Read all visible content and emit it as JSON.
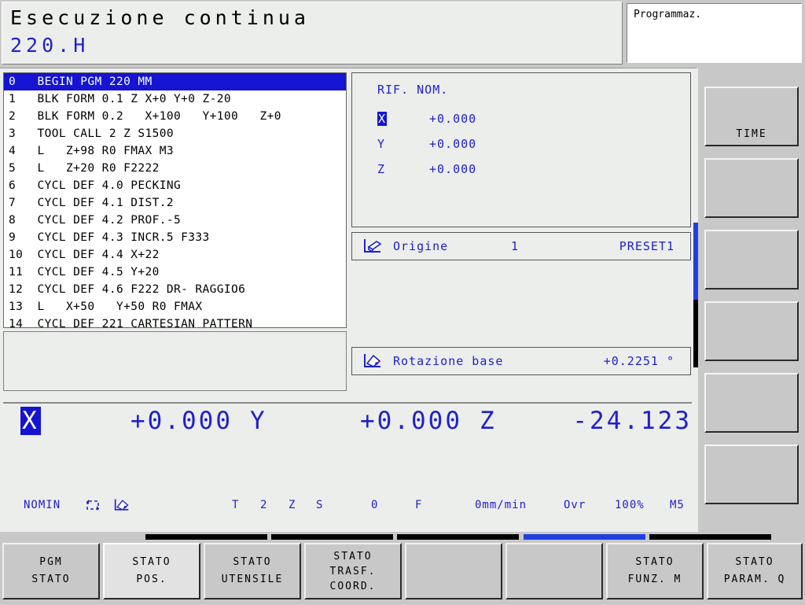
{
  "header": {
    "mode_title": "Esecuzione continua",
    "program_name": "220.H",
    "right_box_label": "Programmaz."
  },
  "program_list": {
    "lines": [
      {
        "text": "0   BEGIN PGM 220 MM",
        "selected": true
      },
      {
        "text": "1   BLK FORM 0.1 Z X+0 Y+0 Z-20",
        "selected": false
      },
      {
        "text": "2   BLK FORM 0.2   X+100   Y+100   Z+0",
        "selected": false
      },
      {
        "text": "3   TOOL CALL 2 Z S1500",
        "selected": false
      },
      {
        "text": "4   L   Z+98 R0 FMAX M3",
        "selected": false
      },
      {
        "text": "5   L   Z+20 R0 F2222",
        "selected": false
      },
      {
        "text": "6   CYCL DEF 4.0 PECKING",
        "selected": false
      },
      {
        "text": "7   CYCL DEF 4.1 DIST.2",
        "selected": false
      },
      {
        "text": "8   CYCL DEF 4.2 PROF.-5",
        "selected": false
      },
      {
        "text": "9   CYCL DEF 4.3 INCR.5 F333",
        "selected": false
      },
      {
        "text": "10  CYCL DEF 4.4 X+22",
        "selected": false
      },
      {
        "text": "11  CYCL DEF 4.5 Y+20",
        "selected": false
      },
      {
        "text": "12  CYCL DEF 4.6 F222 DR- RAGGIO6",
        "selected": false
      },
      {
        "text": "13  L   X+50   Y+50 R0 FMAX",
        "selected": false
      },
      {
        "text": "14  CYCL DEF 221 CARTESIAN PATTERN",
        "selected": false
      }
    ]
  },
  "nominal_panel": {
    "title": "RIF. NOM.",
    "rows": [
      {
        "axis": "X",
        "value": "+0.000",
        "highlighted": true
      },
      {
        "axis": "Y",
        "value": "+0.000",
        "highlighted": false
      },
      {
        "axis": "Z",
        "value": "+0.000",
        "highlighted": false
      }
    ]
  },
  "origine_strip": {
    "icon": "datum-preset-icon",
    "label": "Origine",
    "number": "1",
    "value": "PRESET1"
  },
  "rotazione_strip": {
    "icon": "basic-rotation-icon",
    "label": "Rotazione base",
    "value": "+0.2251 °"
  },
  "dro": {
    "axes": [
      {
        "axis": "X",
        "value": "+0.000",
        "highlighted": true
      },
      {
        "axis": "Y",
        "value": "+0.000",
        "highlighted": false
      },
      {
        "axis": "Z",
        "value": "-24.123",
        "highlighted": false
      }
    ]
  },
  "status_line": {
    "mode": "NOMIN",
    "icon_cycle": "cycle-loop-icon",
    "icon_rotation": "basic-rotation-icon",
    "tool_label": "T",
    "tool_number": "2",
    "tool_axis": "Z",
    "spindle_label": "S",
    "spindle_value": "0",
    "feed_label": "F",
    "feed_value": "0mm/min",
    "ovr_label": "Ovr",
    "ovr_value": "100%",
    "m_function": "M5"
  },
  "right_softkeys": [
    {
      "label": "TIME",
      "active": false
    },
    {
      "label": "",
      "active": false
    },
    {
      "label": "",
      "active": false
    },
    {
      "label": "",
      "active": false
    },
    {
      "label": "",
      "active": false
    },
    {
      "label": "",
      "active": false
    }
  ],
  "bottom_softkeys": [
    {
      "line1": "PGM",
      "line2": "STATO",
      "active": false
    },
    {
      "line1": "STATO",
      "line2": "POS.",
      "active": true
    },
    {
      "line1": "STATO",
      "line2": "UTENSILE",
      "active": false
    },
    {
      "line1": "STATO",
      "line2": "TRASF.",
      "line3": "COORD.",
      "active": false
    },
    {
      "line1": "",
      "line2": "",
      "active": false
    },
    {
      "line1": "",
      "line2": "",
      "active": false
    },
    {
      "line1": "STATO",
      "line2": "FUNZ. M",
      "active": false
    },
    {
      "line1": "STATO",
      "line2": "PARAM. Q",
      "active": false
    }
  ],
  "scroll_indicator": {
    "horizontal_segments": [
      {
        "active": false
      },
      {
        "active": false
      },
      {
        "active": false
      },
      {
        "active": true
      },
      {
        "active": false
      }
    ]
  },
  "colors": {
    "accent_blue": "#2020cc",
    "select_blue": "#1414d2",
    "panel_bg": "#eceeec",
    "chrome_gray": "#c8c8c8"
  }
}
